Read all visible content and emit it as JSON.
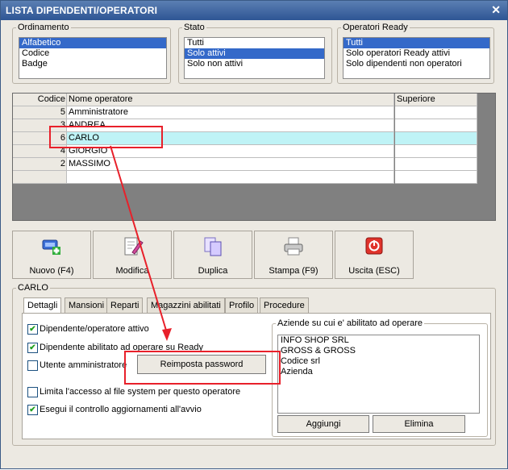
{
  "window": {
    "title": "LISTA DIPENDENTI/OPERATORI",
    "close_glyph": "✕"
  },
  "ordinamento": {
    "legend": "Ordinamento",
    "items": [
      "Alfabetico",
      "Codice",
      "Badge"
    ],
    "selected": 0
  },
  "stato": {
    "legend": "Stato",
    "items": [
      "Tutti",
      "Solo attivi",
      "Solo non attivi"
    ],
    "selected": 1
  },
  "ready": {
    "legend": "Operatori Ready",
    "items": [
      "Tutti",
      "Solo operatori Ready attivi",
      "Solo dipendenti non operatori"
    ],
    "selected": 0
  },
  "grid": {
    "headers": [
      "Codice",
      "Nome operatore",
      "Superiore"
    ],
    "rows": [
      {
        "code": "5",
        "name": "Amministratore",
        "sup": ""
      },
      {
        "code": "3",
        "name": "ANDREA",
        "sup": ""
      },
      {
        "code": "6",
        "name": "CARLO",
        "sup": ""
      },
      {
        "code": "4",
        "name": "GIORGIO",
        "sup": ""
      },
      {
        "code": "2",
        "name": "MASSIMO",
        "sup": ""
      }
    ],
    "selected_row": 2
  },
  "toolbar": {
    "nuovo": "Nuovo (F4)",
    "modifica": "Modifica",
    "duplica": "Duplica",
    "stampa": "Stampa (F9)",
    "uscita": "Uscita (ESC)"
  },
  "detail": {
    "legend": "CARLO",
    "tabs": [
      "Dettagli",
      "Mansioni",
      "Reparti",
      "Magazzini abilitati",
      "Profilo",
      "Procedure"
    ],
    "checkboxes": [
      {
        "label": "Dipendente/operatore attivo",
        "checked": "✔"
      },
      {
        "label": "Dipendente abilitato ad operare su Ready",
        "checked": "✔"
      },
      {
        "label": "Utente amministratore",
        "checked": ""
      },
      {
        "label": "Limita l'accesso al file system per questo operatore",
        "checked": ""
      },
      {
        "label": "Esegui il controllo aggiornamenti all'avvio",
        "checked": "✔"
      }
    ],
    "reset_password": "Reimposta password",
    "aziende": {
      "legend": "Aziende su cui e' abilitato ad operare",
      "items": [
        "INFO SHOP SRL",
        "GROSS & GROSS",
        "Codice srl",
        "Azienda"
      ],
      "add": "Aggiungi",
      "remove": "Elimina"
    }
  },
  "colors": {
    "titlebar": "#2e5594",
    "selection": "#3469c9",
    "row_highlight": "#bff3f6",
    "annotation": "#e8202a"
  }
}
